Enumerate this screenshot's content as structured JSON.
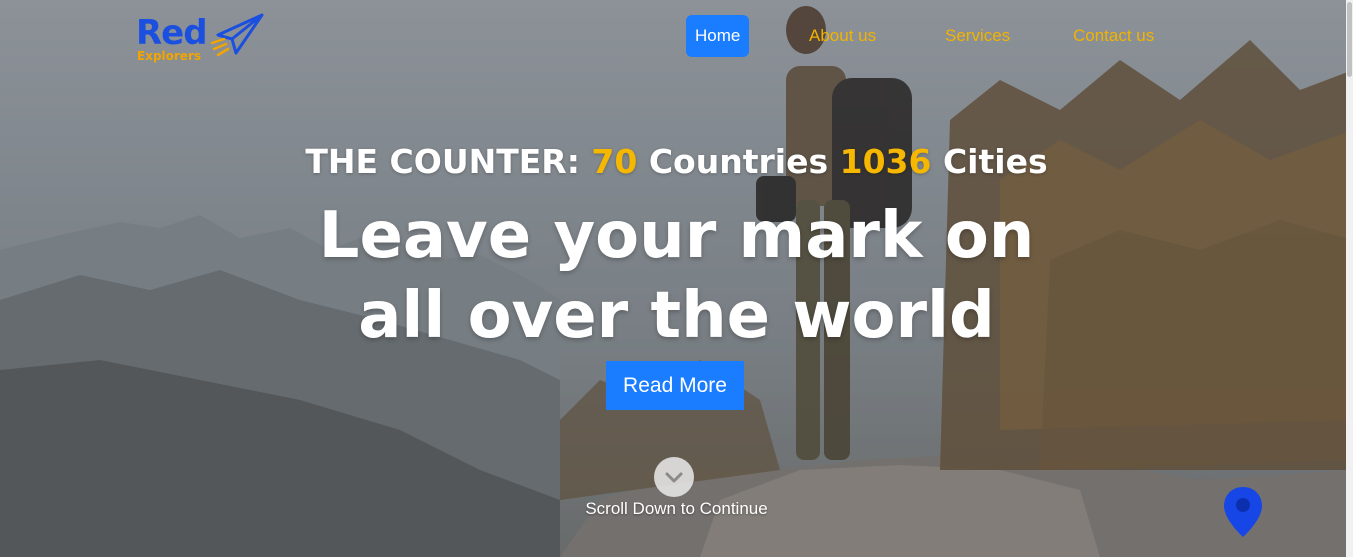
{
  "logo": {
    "title": "Red",
    "subtitle": "Explorers",
    "icon": "paper-plane-icon"
  },
  "nav": {
    "items": [
      {
        "label": "Home",
        "active": true
      },
      {
        "label": "About us",
        "active": false
      },
      {
        "label": "Services",
        "active": false
      },
      {
        "label": "Contact us",
        "active": false
      }
    ]
  },
  "hero": {
    "counter_prefix": "THE COUNTER:",
    "countries_count": "70",
    "countries_label": "Countries",
    "cities_count": "1036",
    "cities_label": "Cities",
    "headline_line1": "Leave your mark on",
    "headline_line2": "all over the world",
    "cta_label": "Read More",
    "scroll_icon": "chevron-down-icon",
    "scroll_text": "Scroll Down to Continue"
  },
  "floating": {
    "map_pin_icon": "map-pin-icon"
  },
  "colors": {
    "accent_blue": "#1a7cff",
    "brand_blue": "#1a4fe0",
    "accent_yellow": "#f5b700",
    "nav_text": "#f2b300"
  }
}
